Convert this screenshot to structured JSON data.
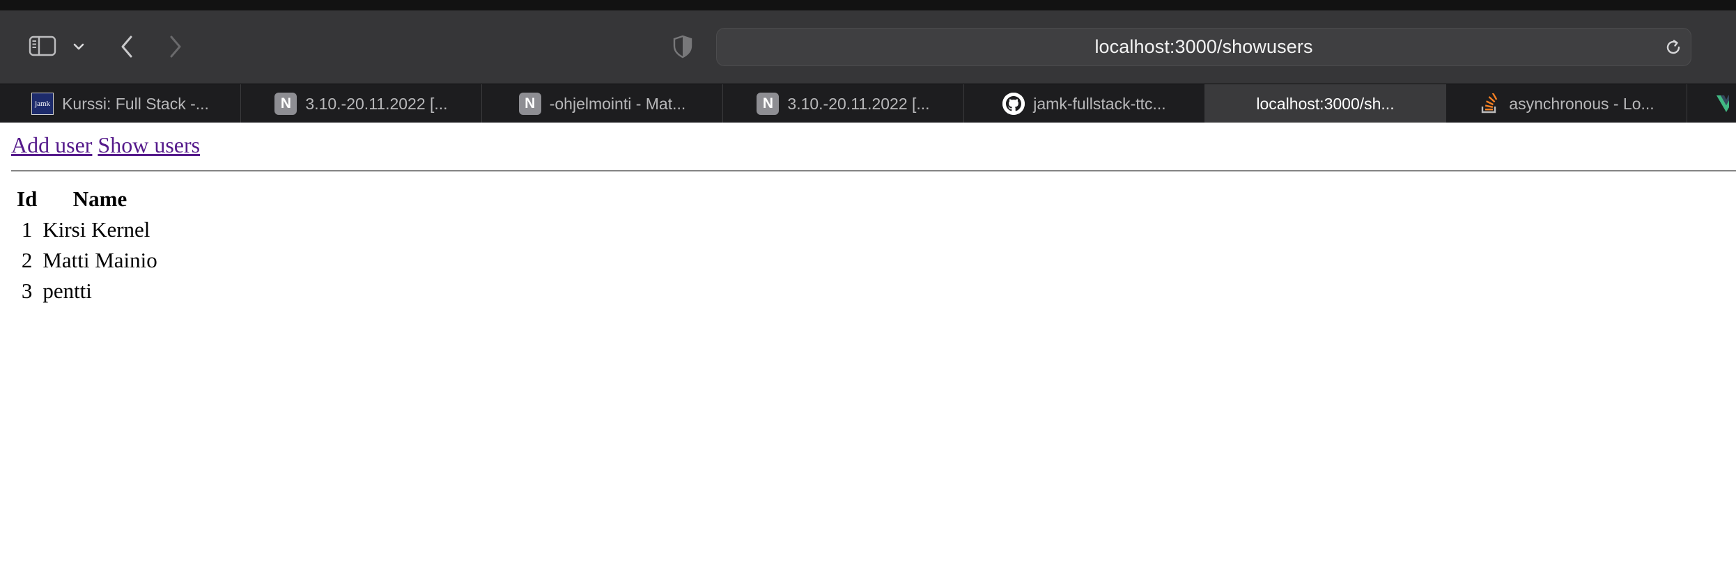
{
  "browser": {
    "url": "localhost:3000/showusers",
    "tabs": [
      {
        "title": "Kurssi: Full Stack -...",
        "icon": "jamk-icon",
        "icon_text": "jamk",
        "active": false
      },
      {
        "title": "3.10.-20.11.2022 [...",
        "icon": "notion-icon",
        "icon_text": "N",
        "active": false
      },
      {
        "title": "-ohjelmointi - Mat...",
        "icon": "notion-icon",
        "icon_text": "N",
        "active": false
      },
      {
        "title": "3.10.-20.11.2022 [...",
        "icon": "notion-icon",
        "icon_text": "N",
        "active": false
      },
      {
        "title": "jamk-fullstack-ttc...",
        "icon": "github-icon",
        "active": false
      },
      {
        "title": "localhost:3000/sh...",
        "icon": "none",
        "active": true
      },
      {
        "title": "asynchronous - Lo...",
        "icon": "stackoverflow-icon",
        "active": false
      }
    ],
    "colors": {
      "toolbar": "#363638",
      "tabbar": "#1d1d1f",
      "active_tab": "#3a3a3c",
      "link_visited": "#551a8b"
    }
  },
  "page": {
    "nav": {
      "add_user": "Add user",
      "show_users": "Show users"
    },
    "table": {
      "headers": {
        "id": "Id",
        "name": "Name"
      },
      "rows": [
        {
          "id": "1",
          "name": "Kirsi Kernel"
        },
        {
          "id": "2",
          "name": "Matti Mainio"
        },
        {
          "id": "3",
          "name": "pentti"
        }
      ]
    }
  }
}
